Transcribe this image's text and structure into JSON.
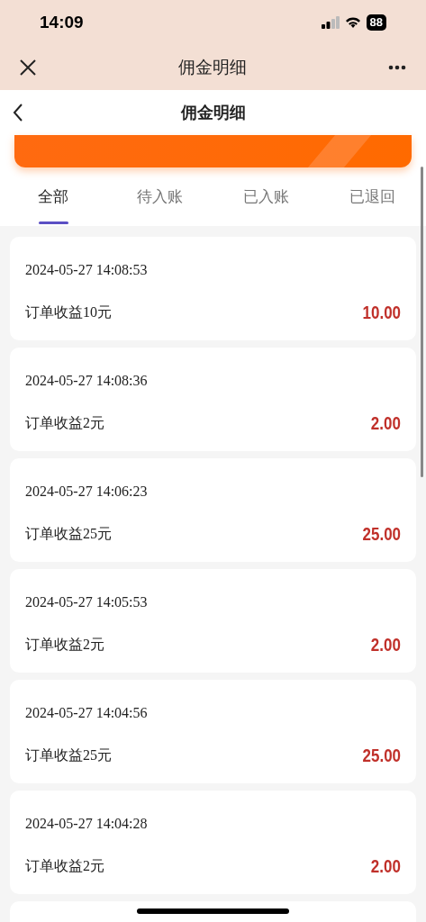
{
  "status_bar": {
    "time": "14:09",
    "battery": "88"
  },
  "top_bar": {
    "title": "佣金明细"
  },
  "header": {
    "title": "佣金明细"
  },
  "tabs": [
    {
      "label": "全部",
      "selected": true
    },
    {
      "label": "待入账",
      "selected": false
    },
    {
      "label": "已入账",
      "selected": false
    },
    {
      "label": "已退回",
      "selected": false
    }
  ],
  "records": [
    {
      "time": "2024-05-27 14:08:53",
      "title": "订单收益10元",
      "amount": "10.00"
    },
    {
      "time": "2024-05-27 14:08:36",
      "title": "订单收益2元",
      "amount": "2.00"
    },
    {
      "time": "2024-05-27 14:06:23",
      "title": "订单收益25元",
      "amount": "25.00"
    },
    {
      "time": "2024-05-27 14:05:53",
      "title": "订单收益2元",
      "amount": "2.00"
    },
    {
      "time": "2024-05-27 14:04:56",
      "title": "订单收益25元",
      "amount": "25.00"
    },
    {
      "time": "2024-05-27 14:04:28",
      "title": "订单收益2元",
      "amount": "2.00"
    }
  ]
}
